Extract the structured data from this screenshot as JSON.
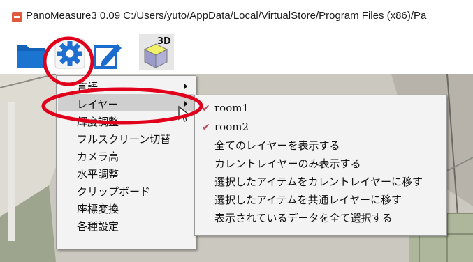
{
  "window": {
    "title": "PanoMeasure3 0.09  C:/Users/yuto/AppData/Local/VirtualStore/Program Files (x86)/Pa"
  },
  "toolbar": {
    "icons": [
      "folder-icon",
      "gear-icon",
      "edit-icon",
      "3d-cube-icon"
    ],
    "cube_label": "3D"
  },
  "context_menu": {
    "items": [
      {
        "label": "言語",
        "has_submenu": true
      },
      {
        "label": "レイヤー",
        "has_submenu": true,
        "highlighted": true
      },
      {
        "label": "輝度調整"
      },
      {
        "label": "フルスクリーン切替"
      },
      {
        "label": "カメラ高"
      },
      {
        "label": "水平調整"
      },
      {
        "label": "クリップボード"
      },
      {
        "label": "座標変換"
      },
      {
        "label": "各種設定"
      }
    ]
  },
  "layer_submenu": {
    "layers": [
      {
        "label": "room1",
        "checked": true
      },
      {
        "label": "room2",
        "checked": true
      }
    ],
    "actions": [
      "全てのレイヤーを表示する",
      "カレントレイヤーのみ表示する",
      "選択したアイテムをカレントレイヤーに移す",
      "選択したアイテムを共通レイヤーに移す",
      "表示されているデータを全て選択する"
    ]
  },
  "colors": {
    "annotation_red": "#e0001b",
    "check_mark": "#b24a5a",
    "menu_bg": "#f3f3f3",
    "menu_highlight": "#cfcfcf"
  }
}
